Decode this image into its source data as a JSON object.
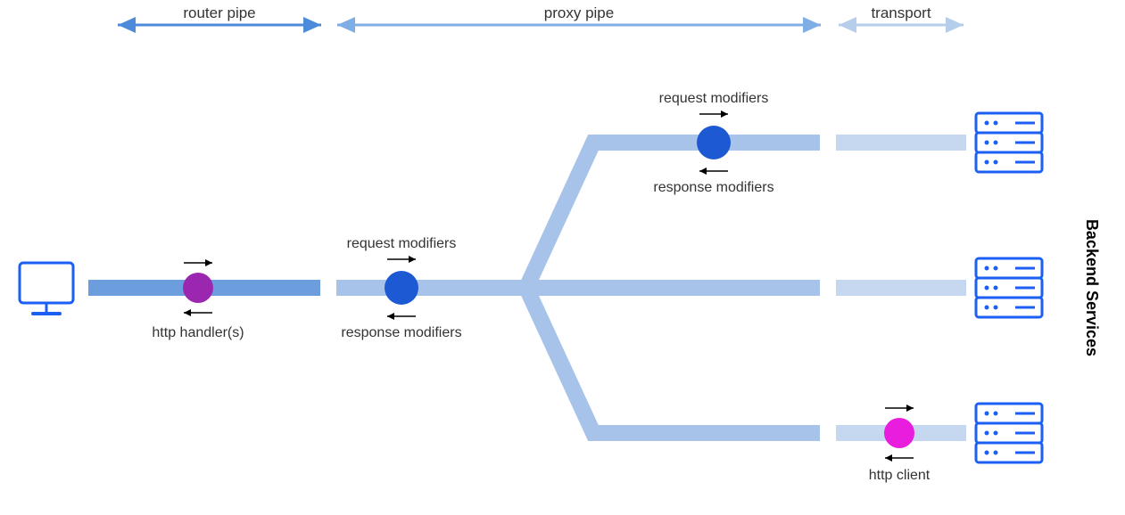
{
  "sections": {
    "router": "router pipe",
    "proxy": "proxy pipe",
    "transport": "transport"
  },
  "nodes": {
    "http_handlers": "http handler(s)",
    "request_modifiers_1": "request modifiers",
    "response_modifiers_1": "response modifiers",
    "request_modifiers_2": "request modifiers",
    "response_modifiers_2": "response modifiers",
    "http_client": "http client"
  },
  "backend_title": "Backend Services"
}
